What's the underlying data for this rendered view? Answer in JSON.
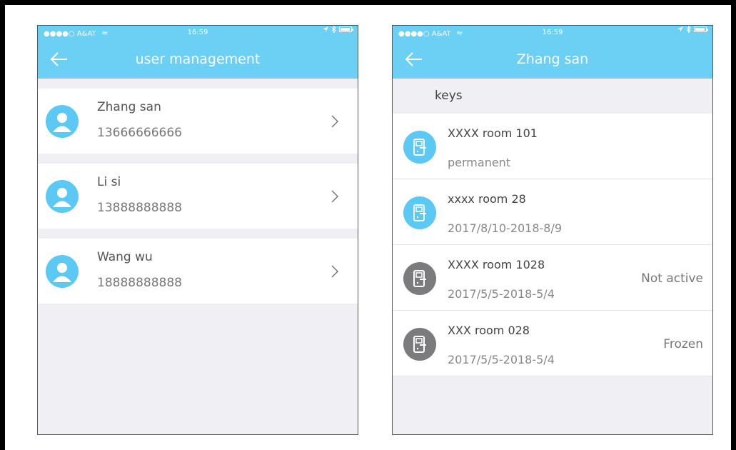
{
  "status_bar": {
    "carrier": "●●●●○ A&AT",
    "time": "16:59"
  },
  "left_screen": {
    "title": "user management",
    "users": [
      {
        "name": "Zhang san",
        "phone": "13666666666"
      },
      {
        "name": "Li si",
        "phone": "13888888888"
      },
      {
        "name": "Wang wu",
        "phone": "18888888888"
      }
    ]
  },
  "right_screen": {
    "title": "Zhang san",
    "section_label": "keys",
    "keys": [
      {
        "room": "XXXX room 101",
        "validity": "permanent",
        "status": "",
        "icon_color": "#5bc9f3"
      },
      {
        "room": "xxxx room 28",
        "validity": "2017/8/10-2018-8/9",
        "status": "",
        "icon_color": "#5bc9f3"
      },
      {
        "room": "XXXX room 1028",
        "validity": "2017/5/5-2018-5/4",
        "status": "Not active",
        "icon_color": "#7b7b7d"
      },
      {
        "room": "XXX room 028",
        "validity": "2017/5/5-2018-5/4",
        "status": "Frozen",
        "icon_color": "#7b7b7d"
      }
    ]
  },
  "icons": {
    "back": "arrow-left-icon",
    "chevron": "chevron-right-icon",
    "avatar": "user-avatar-icon",
    "key": "door-lock-icon",
    "location": "location-arrow-icon",
    "bluetooth": "bluetooth-icon",
    "battery": "battery-icon",
    "wifi": "wifi-icon"
  },
  "colors": {
    "accent": "#6ccff4",
    "active_key": "#5bc9f3",
    "inactive_key": "#7b7b7d",
    "background": "#efeff4"
  }
}
